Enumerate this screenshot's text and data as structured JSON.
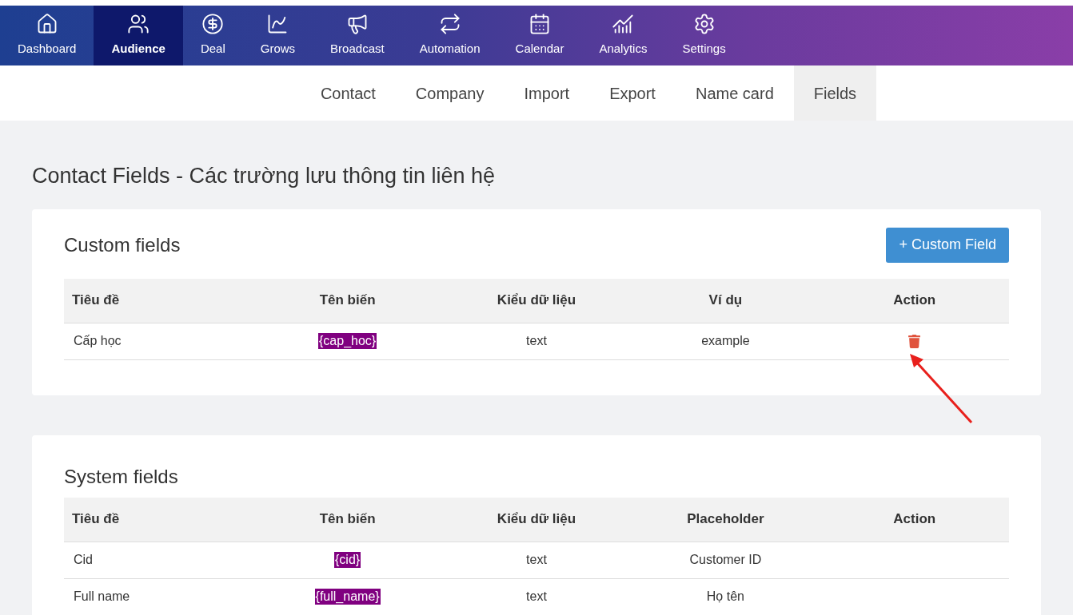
{
  "nav": [
    {
      "kind": "home",
      "label": "Dashboard",
      "selected": false
    },
    {
      "kind": "users",
      "label": "Audience",
      "selected": true
    },
    {
      "kind": "dollar",
      "label": "Deal",
      "selected": false
    },
    {
      "kind": "growth",
      "label": "Grows",
      "selected": false
    },
    {
      "kind": "megaphone",
      "label": "Broadcast",
      "selected": false
    },
    {
      "kind": "repeat",
      "label": "Automation",
      "selected": false
    },
    {
      "kind": "calendar",
      "label": "Calendar",
      "selected": false
    },
    {
      "kind": "analytics",
      "label": "Analytics",
      "selected": false
    },
    {
      "kind": "gear",
      "label": "Settings",
      "selected": false
    }
  ],
  "subtabs": [
    {
      "label": "Contact",
      "selected": false
    },
    {
      "label": "Company",
      "selected": false
    },
    {
      "label": "Import",
      "selected": false
    },
    {
      "label": "Export",
      "selected": false
    },
    {
      "label": "Name card",
      "selected": false
    },
    {
      "label": "Fields",
      "selected": true
    }
  ],
  "page_title": "Contact Fields - Các trường lưu thông tin liên hệ",
  "custom_fields": {
    "title": "Custom fields",
    "add_button": "+ Custom Field",
    "columns": [
      "Tiêu đề",
      "Tên biến",
      "Kiểu dữ liệu",
      "Ví dụ",
      "Action"
    ],
    "rows": [
      {
        "title": "Cấp học",
        "variable": "{cap_hoc}",
        "type": "text",
        "example": "example",
        "deletable": true
      }
    ]
  },
  "system_fields": {
    "title": "System fields",
    "columns": [
      "Tiêu đề",
      "Tên biến",
      "Kiểu dữ liệu",
      "Placeholder",
      "Action"
    ],
    "rows": [
      {
        "title": "Cid",
        "variable": "{cid}",
        "type": "text",
        "example": "Customer ID",
        "deletable": false
      },
      {
        "title": "Full name",
        "variable": "{full_name}",
        "type": "text",
        "example": "Họ tên",
        "deletable": false
      }
    ]
  }
}
